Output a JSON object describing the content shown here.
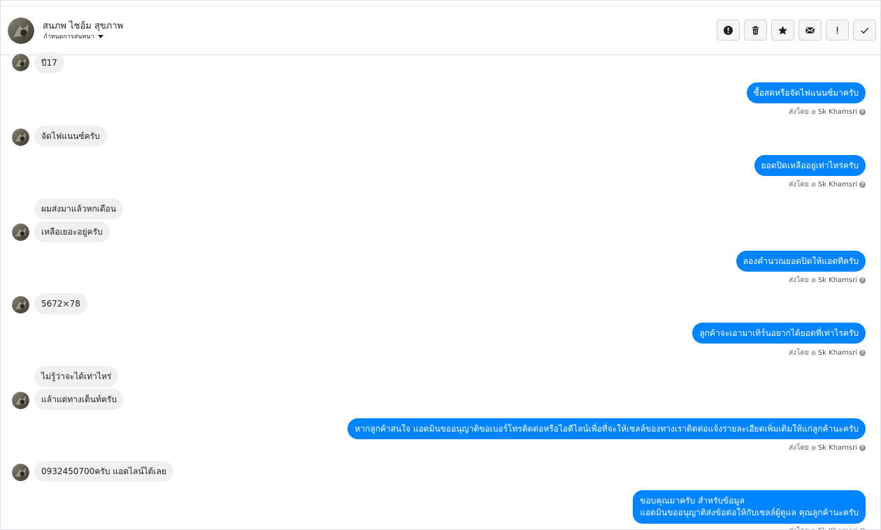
{
  "header": {
    "contact_name": "สนภพ ไชอ้ม สุขภาพ",
    "subtitle": "กำหนดการสนทนา",
    "actions": [
      "report-icon",
      "trash-icon",
      "star-icon",
      "mail-icon",
      "exclamation-icon",
      "check-icon"
    ]
  },
  "sent_by": {
    "prefix": "ส่งโดย",
    "agent": "Sk Khamsri"
  },
  "messages": {
    "m1": "ปี17",
    "m2": "ซื้อสดหรือจัดไฟแนนซ์มาครับ",
    "m3": "จัดไฟแนนซ์ครับ",
    "m4": "ยอดปิดเหลืออยู่เท่าไหร่ครับ",
    "m5": "ผมส่งมาแล้วหกเดือน",
    "m6": "เหลือเยอะอยู่ครับ",
    "m7": "ลองคำนวณยอดปิดให้แอดทีครับ",
    "m8": "5672×78",
    "m9": "ลูกค้าจะเอามาเทิร์นอยากได้ยอดที่เท่าไรครับ",
    "m10": "ไม่รู้ว่าจะได้เท่าไหร่",
    "m11": "แล้าแต่ทางเต็นท์ครับ",
    "m12": "หากลูกค้าสนใจ แอดมินขออนุญาติขอเบอร์โทรติดต่อหรือไอดีไลน์เพื่อที่จะให้เซลล์ของทางเราติดต่อแจ้งรายละเอียดเพิ่มเติมให้แก่ลูกค้านะครับ",
    "m13": "0932450700ครับ แอดไลน์ได้เลย",
    "m14_line1": "ขอบคุณมาครับ สำหรับข้อมูล",
    "m14_line2": "แอดมินขออนุญาติส่งข้อต่อให้กับเซลล์ผู้ดูแล คุณลูกค้านะครับ"
  },
  "colors": {
    "outgoing_bubble": "#0084ff",
    "incoming_bubble": "#f1f0f0"
  }
}
